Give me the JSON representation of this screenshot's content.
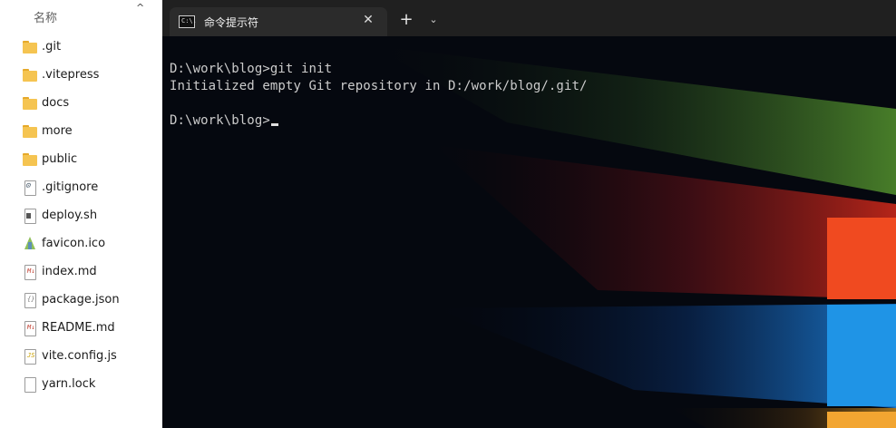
{
  "explorer": {
    "column_header": "名称",
    "sort_icon": "chevron-up-icon",
    "items": [
      {
        "name": ".git",
        "type": "folder"
      },
      {
        "name": ".vitepress",
        "type": "folder"
      },
      {
        "name": "docs",
        "type": "folder"
      },
      {
        "name": "more",
        "type": "folder"
      },
      {
        "name": "public",
        "type": "folder"
      },
      {
        "name": ".gitignore",
        "type": "config-file"
      },
      {
        "name": "deploy.sh",
        "type": "shell-file"
      },
      {
        "name": "favicon.ico",
        "type": "image-file"
      },
      {
        "name": "index.md",
        "type": "markdown-file"
      },
      {
        "name": "package.json",
        "type": "json-file"
      },
      {
        "name": "README.md",
        "type": "markdown-file"
      },
      {
        "name": "vite.config.js",
        "type": "js-file"
      },
      {
        "name": "yarn.lock",
        "type": "text-file"
      }
    ]
  },
  "terminal": {
    "tab_title": "命令提示符",
    "tab_icon_text": "C:\\.",
    "close_symbol": "✕",
    "new_tab_symbol": "+",
    "dropdown_symbol": "⌄",
    "lines": [
      "D:\\work\\blog>git init",
      "Initialized empty Git repository in D:/work/blog/.git/",
      "",
      "D:\\work\\blog>"
    ]
  },
  "colors": {
    "tabbar": "#202020",
    "active_tab": "#2b2b2b",
    "console_bg": "#05080f",
    "console_text": "#cccccc",
    "folder": "#f5c451"
  }
}
